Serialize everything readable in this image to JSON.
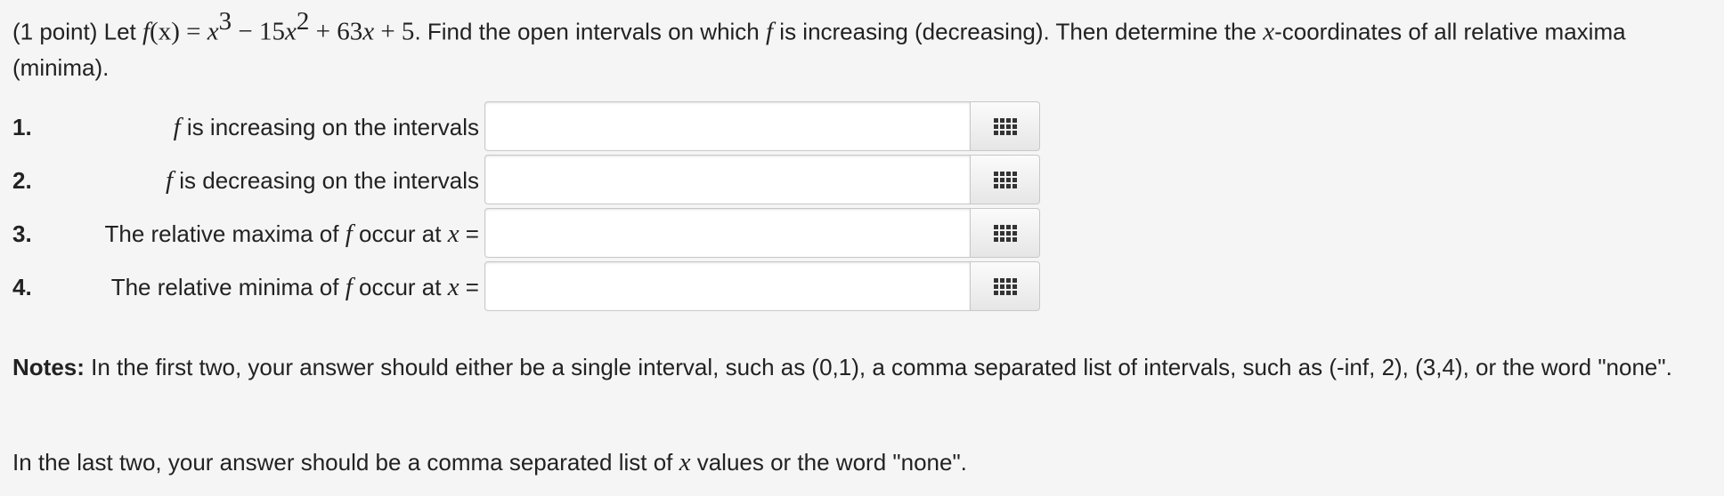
{
  "problem": {
    "prefix": "(1 point) Let ",
    "func_name": "f",
    "func_arg": "(x)",
    "equals": " = ",
    "t1": "x",
    "t1_exp": "3",
    "minus": " − 15",
    "t2": "x",
    "t2_exp": "2",
    "plus63": " + 63",
    "t3": "x",
    "plus5": " + 5",
    "text_a": ". Find the open intervals on which ",
    "f": "f",
    "text_b": " is increasing (decreasing). Then determine the ",
    "x": "x",
    "text_c": "-coordinates of all relative maxima (minima)."
  },
  "questions": [
    {
      "number": "1.",
      "pre": "",
      "var": "f",
      "post": " is increasing on the intervals",
      "xvar": "",
      "eq": "",
      "value": ""
    },
    {
      "number": "2.",
      "pre": "",
      "var": "f",
      "post": " is decreasing on the intervals",
      "xvar": "",
      "eq": "",
      "value": ""
    },
    {
      "number": "3.",
      "pre": "The relative maxima of ",
      "var": "f",
      "post": " occur at ",
      "xvar": "x",
      "eq": " =",
      "value": ""
    },
    {
      "number": "4.",
      "pre": "The relative minima of ",
      "var": "f",
      "post": " occur at ",
      "xvar": "x",
      "eq": " =",
      "value": ""
    }
  ],
  "palette_icon": "equation-palette-icon",
  "notes": {
    "heading": "Notes:",
    "text": " In the first two, your answer should either be a single interval, such as (0,1), a comma separated list of intervals, such as (-inf, 2), (3,4), or the word \"none\"."
  },
  "last_note": {
    "pre": "In the last two, your answer should be a comma separated list of ",
    "var": "x",
    "post": " values or the word \"none\"."
  }
}
